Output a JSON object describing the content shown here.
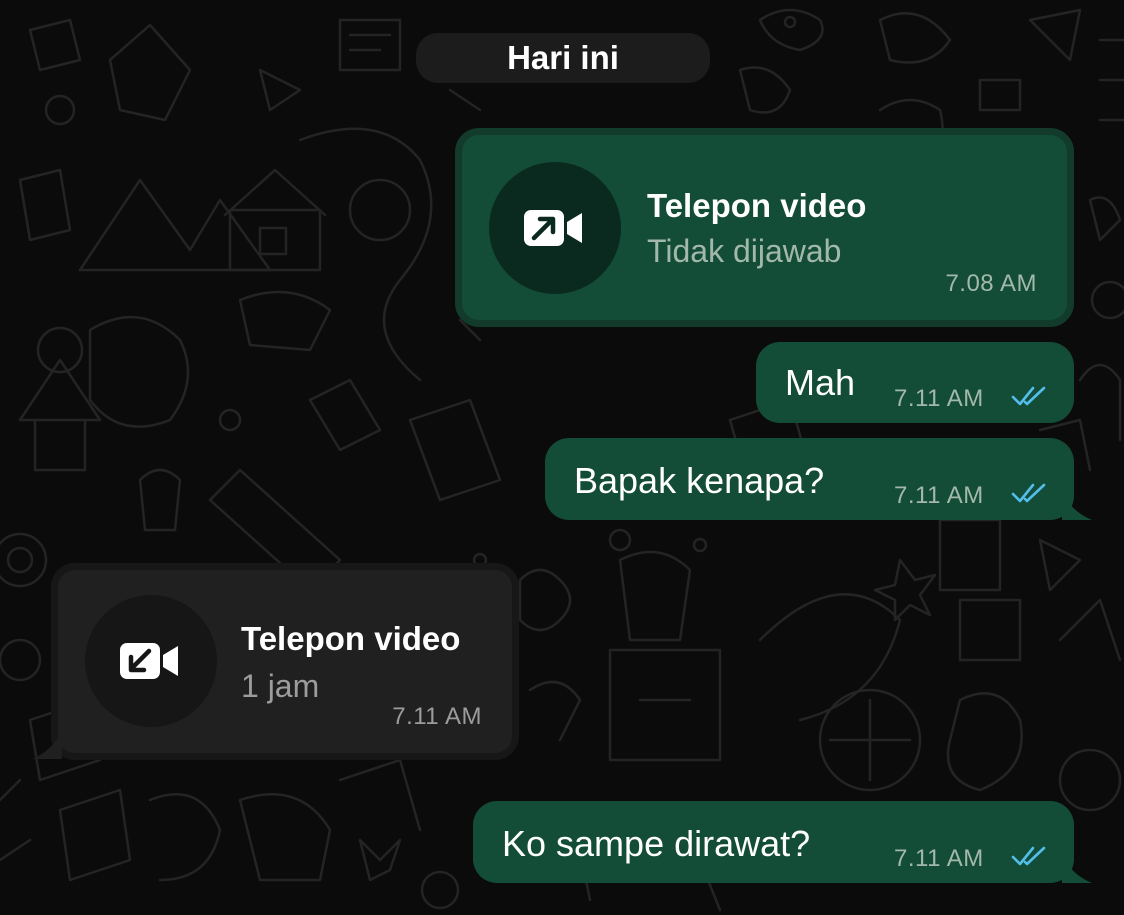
{
  "date_divider": "Hari ini",
  "messages": [
    {
      "type": "call",
      "direction": "outgoing",
      "title": "Telepon video",
      "status": "Tidak dijawab",
      "time": "7.08 AM",
      "icon": "outgoing-video-call-icon"
    },
    {
      "type": "text",
      "direction": "outgoing",
      "text": "Mah",
      "time": "7.11 AM",
      "read": true
    },
    {
      "type": "text",
      "direction": "outgoing",
      "text": "Bapak kenapa?",
      "time": "7.11 AM",
      "read": true
    },
    {
      "type": "call",
      "direction": "incoming",
      "title": "Telepon video",
      "status": "1 jam",
      "time": "7.11 AM",
      "icon": "incoming-video-call-icon"
    },
    {
      "type": "text",
      "direction": "outgoing",
      "text": "Ko sampe dirawat?",
      "time": "7.11 AM",
      "read": true
    }
  ],
  "colors": {
    "background": "#0b0b0b",
    "outgoing_bubble": "#134d37",
    "incoming_bubble": "#1f1f1f",
    "read_ticks": "#53bdeb"
  }
}
